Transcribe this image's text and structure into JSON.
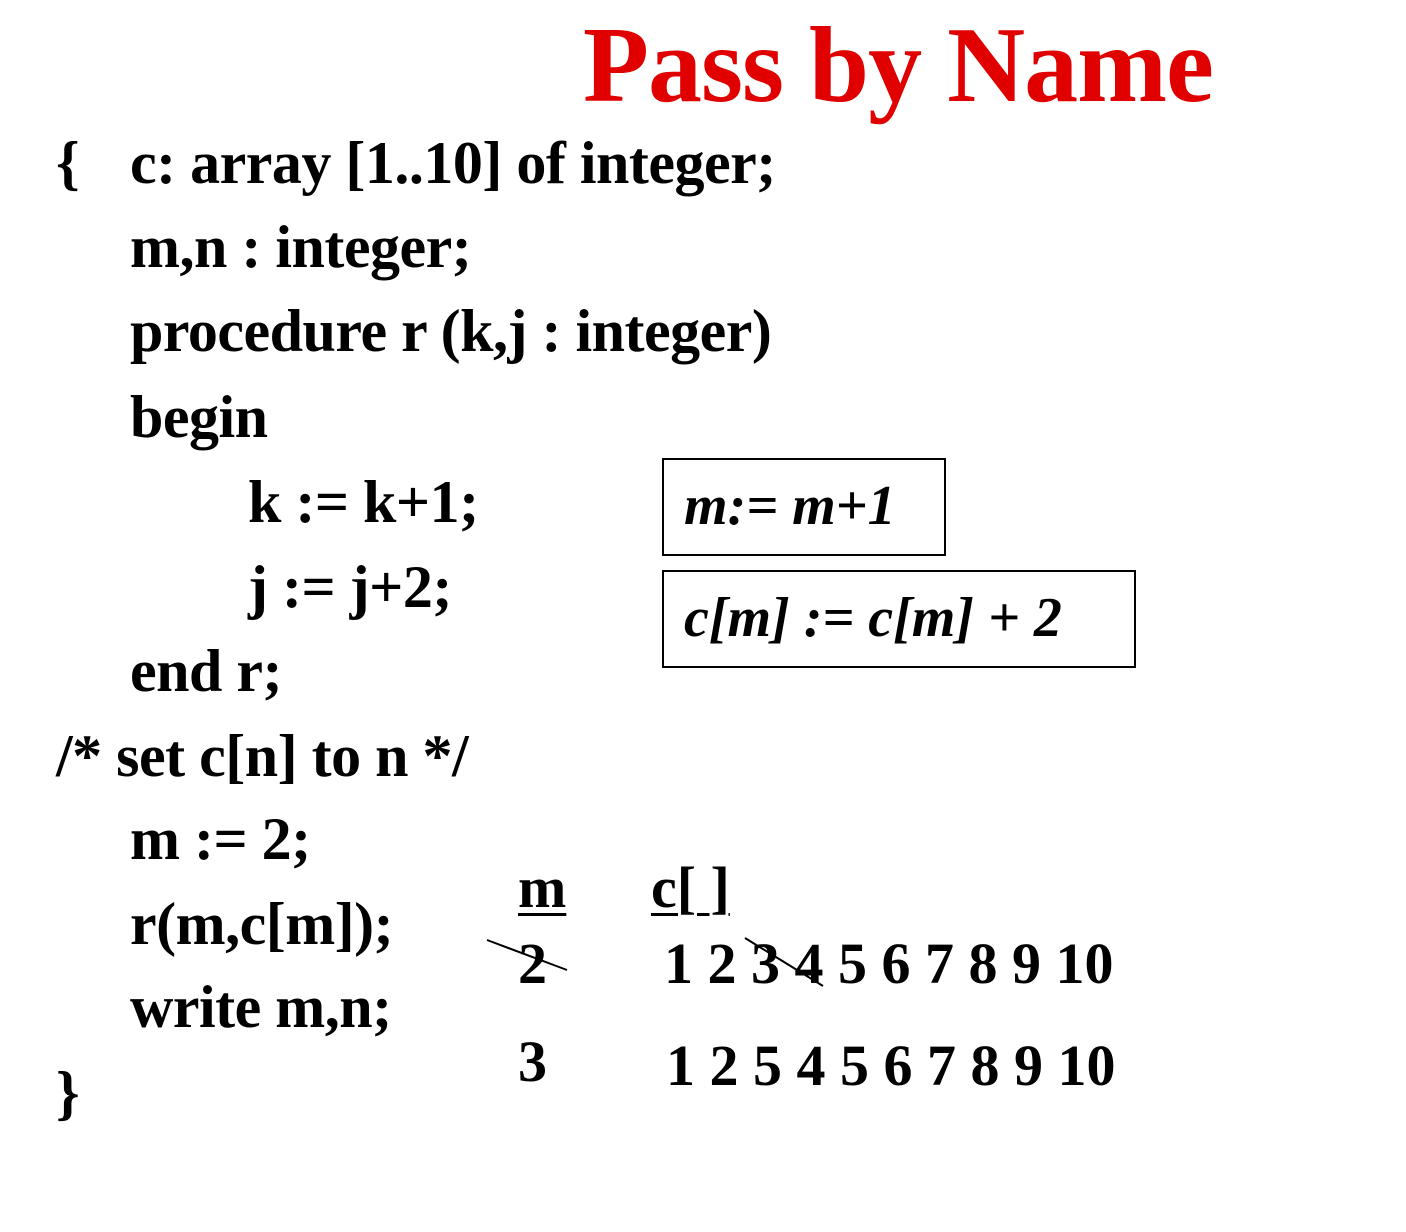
{
  "title": "Pass by Name",
  "code": {
    "open_brace": "{",
    "line1": "c: array [1..10] of integer;",
    "line2": "m,n : integer;",
    "line3": "procedure r (k,j : integer)",
    "line4": "begin",
    "line5": "k := k+1;",
    "line6": "j := j+2;",
    "line7": "end r;",
    "line8": "/* set c[n]  to n */",
    "line9": "m := 2;",
    "line10": "r(m,c[m]);",
    "line11": "write m,n;",
    "close_brace": "}"
  },
  "boxes": {
    "box1": "m:= m+1",
    "box2": "c[m] := c[m] + 2"
  },
  "trace": {
    "header_m": "m",
    "header_c": "c[ ]",
    "row1_m": "2",
    "row1_c": "1 2 3 4 5 6 7 8 9 10",
    "row2_m": "3",
    "row2_c": "1 2 5 4 5 6 7 8 9 10"
  },
  "colors": {
    "title": "#e00000",
    "text": "#000000"
  }
}
